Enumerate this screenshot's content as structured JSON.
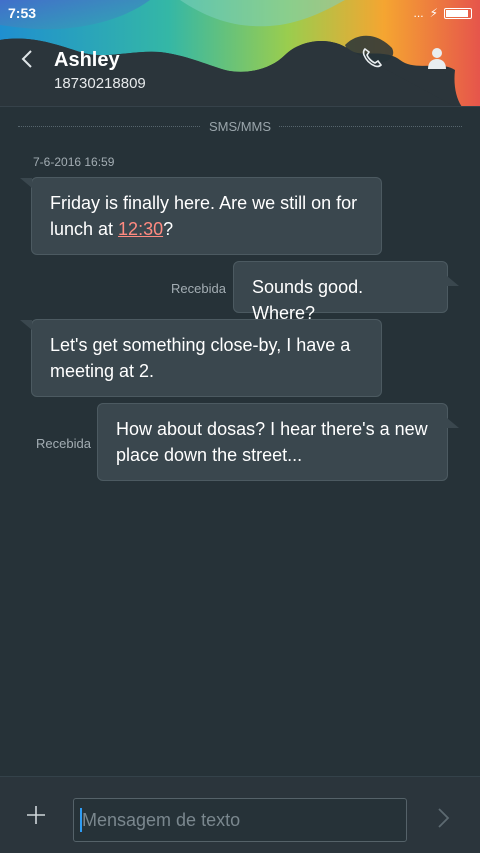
{
  "status_bar": {
    "time": "7:53",
    "signal_dots": "...",
    "charging_glyph": "⚡"
  },
  "header": {
    "contact_name": "Ashley",
    "contact_number": "18730218809",
    "back_icon": "chevron-left-icon",
    "call_icon": "phone-icon",
    "contact_icon": "person-icon"
  },
  "thread": {
    "channel_label": "SMS/MMS",
    "timestamp": "7-6-2016 16:59",
    "messages": [
      {
        "direction": "incoming",
        "text_before": "Friday is finally here. Are we still on for lunch at ",
        "link": "12:30",
        "text_after": "?"
      },
      {
        "direction": "outgoing",
        "text": "Sounds good. Where?",
        "status": "Recebida"
      },
      {
        "direction": "incoming",
        "text": "Let's get something close-by, I have a meeting at 2."
      },
      {
        "direction": "outgoing",
        "text": "How about dosas? I hear there's a new place down the street...",
        "status": "Recebida"
      }
    ]
  },
  "composer": {
    "placeholder": "Mensagem de texto",
    "value": "",
    "add_icon": "plus-icon",
    "send_icon": "send-chevron-icon"
  },
  "colors": {
    "background": "#263238",
    "bubble": "#3a474e",
    "link": "#ff8a80",
    "cursor": "#2f9cf3"
  }
}
